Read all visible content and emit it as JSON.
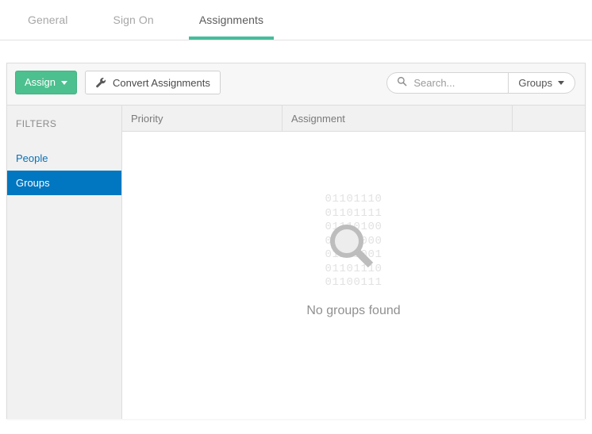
{
  "tabs": [
    {
      "label": "General",
      "active": false
    },
    {
      "label": "Sign On",
      "active": false
    },
    {
      "label": "Assignments",
      "active": true
    }
  ],
  "toolbar": {
    "assign_label": "Assign",
    "assign_icon": "caret-down-icon",
    "convert_label": "Convert Assignments",
    "convert_icon": "wrench-icon",
    "search": {
      "icon": "search-icon",
      "placeholder": "Search...",
      "value": "",
      "scope_label": "Groups",
      "scope_icon": "caret-down-icon"
    }
  },
  "sidebar": {
    "title": "FILTERS",
    "items": [
      {
        "label": "People",
        "selected": false
      },
      {
        "label": "Groups",
        "selected": true
      }
    ]
  },
  "table": {
    "columns": [
      {
        "label": "Priority"
      },
      {
        "label": "Assignment"
      },
      {
        "label": ""
      }
    ],
    "rows": []
  },
  "empty_state": {
    "icon": "magnifier-icon",
    "binary_lines": [
      "01101110",
      "01101111",
      "01110100",
      "01101000",
      "01101001",
      "01101110",
      "01100111"
    ],
    "message": "No groups found"
  },
  "colors": {
    "accent_green": "#4cc08e",
    "tab_underline": "#47bd9c",
    "selected_blue": "#0077c0",
    "link_blue": "#0b72b5",
    "panel_border": "#dddddd",
    "toolbar_bg": "#f7f7f7",
    "sidebar_bg": "#f1f1f1",
    "muted_text": "#909090",
    "binary_text": "#e2e2e2"
  }
}
